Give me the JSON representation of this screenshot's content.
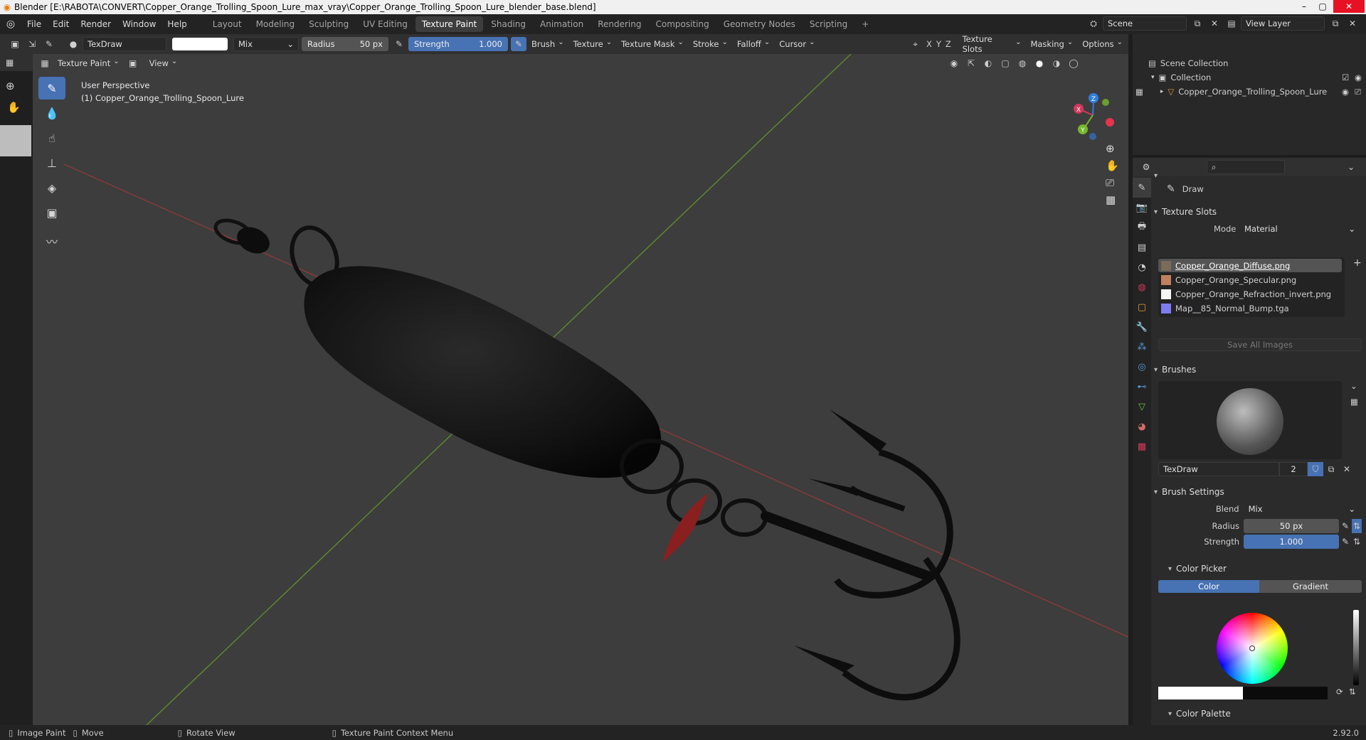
{
  "window": {
    "title": "Blender [E:\\RABOTA\\CONVERT\\Copper_Orange_Trolling_Spoon_Lure_max_vray\\Copper_Orange_Trolling_Spoon_Lure_blender_base.blend]"
  },
  "menu": [
    "File",
    "Edit",
    "Render",
    "Window",
    "Help"
  ],
  "workspaces": [
    "Layout",
    "Modeling",
    "Sculpting",
    "UV Editing",
    "Texture Paint",
    "Shading",
    "Animation",
    "Rendering",
    "Compositing",
    "Geometry Nodes",
    "Scripting"
  ],
  "active_workspace": "Texture Paint",
  "scene": {
    "name": "Scene",
    "view_layer": "View Layer"
  },
  "tool_header": {
    "brush_name": "TexDraw",
    "blend": "Mix",
    "radius_label": "Radius",
    "radius_value": "50 px",
    "strength_label": "Strength",
    "strength_value": "1.000",
    "menus": [
      "Brush",
      "Texture",
      "Texture Mask",
      "Stroke",
      "Falloff",
      "Cursor"
    ],
    "axes": [
      "X",
      "Y",
      "Z"
    ],
    "right_menus": [
      "Texture Slots",
      "Masking",
      "Options"
    ]
  },
  "viewport_header": {
    "mode": "Texture Paint",
    "view": "View"
  },
  "viewport": {
    "perspective": "User Perspective",
    "object": "(1) Copper_Orange_Trolling_Spoon_Lure"
  },
  "gizmo": {
    "x": "X",
    "y": "Y",
    "z": "Z"
  },
  "outliner": {
    "root": "Scene Collection",
    "collection": "Collection",
    "object": "Copper_Orange_Trolling_Spoon_Lure"
  },
  "properties": {
    "tool_name": "Draw",
    "texture_slots_title": "Texture Slots",
    "mode_label": "Mode",
    "mode_value": "Material",
    "slots": [
      "Copper_Orange_Diffuse.png",
      "Copper_Orange_Specular.png",
      "Copper_Orange_Refraction_invert.png",
      "Map__85_Normal_Bump.tga"
    ],
    "save_all": "Save All Images",
    "brushes_title": "Brushes",
    "brush_name": "TexDraw",
    "brush_users": "2",
    "brush_settings_title": "Brush Settings",
    "blend_label": "Blend",
    "blend_value": "Mix",
    "radius_label": "Radius",
    "radius_value": "50 px",
    "strength_label": "Strength",
    "strength_value": "1.000",
    "color_picker_title": "Color Picker",
    "color_tab": "Color",
    "gradient_tab": "Gradient",
    "color_palette_title": "Color Palette"
  },
  "statusbar": {
    "image_paint": "Image Paint",
    "move": "Move",
    "rotate": "Rotate View",
    "context": "Texture Paint Context Menu",
    "version": "2.92.0"
  }
}
